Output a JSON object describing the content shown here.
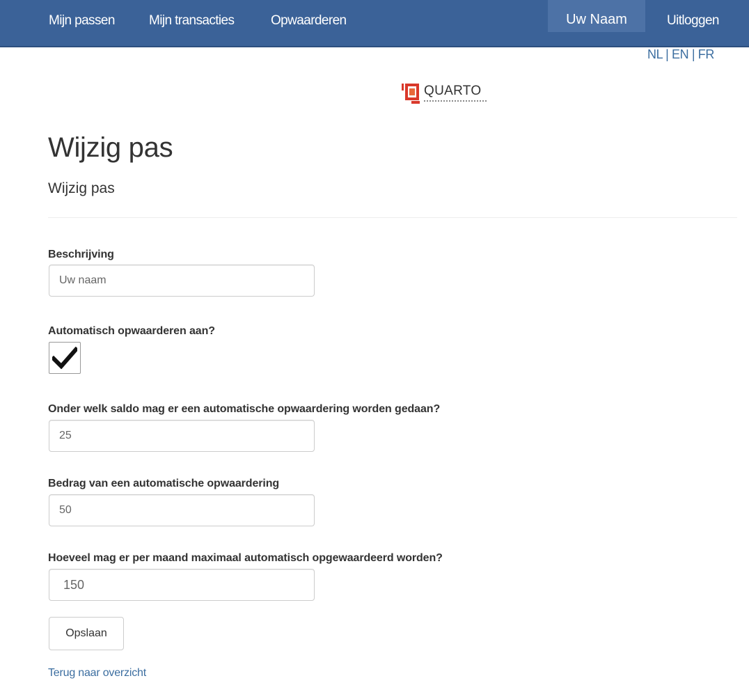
{
  "nav": {
    "links": [
      "Mijn passen",
      "Mijn transacties",
      "Opwaarderen"
    ],
    "user": "Uw Naam",
    "logout": "Uitloggen"
  },
  "lang": [
    "NL",
    "EN",
    "FR"
  ],
  "logo": {
    "text": "QUARTO",
    "icon": "quarto-logo-icon"
  },
  "page": {
    "title": "Wijzig pas",
    "subtitle": "Wijzig pas"
  },
  "form": {
    "description": {
      "label": "Beschrijving",
      "value": "Uw naam"
    },
    "auto_topup": {
      "label": "Automatisch opwaarderen aan?",
      "checked": true
    },
    "threshold": {
      "label": "Onder welk saldo mag er een automatische opwaardering worden gedaan?",
      "value": "25"
    },
    "amount": {
      "label": "Bedrag van een automatische opwaardering",
      "value": "50"
    },
    "monthly_max": {
      "label": "Hoeveel mag er per maand maximaal automatisch opgewaardeerd worden?",
      "value": "150"
    },
    "save_label": "Opslaan"
  },
  "back_link": "Terug naar overzicht",
  "colors": {
    "navbar": "#3b6298",
    "link": "#3c6ea0",
    "logo_red": "#d9382a"
  }
}
